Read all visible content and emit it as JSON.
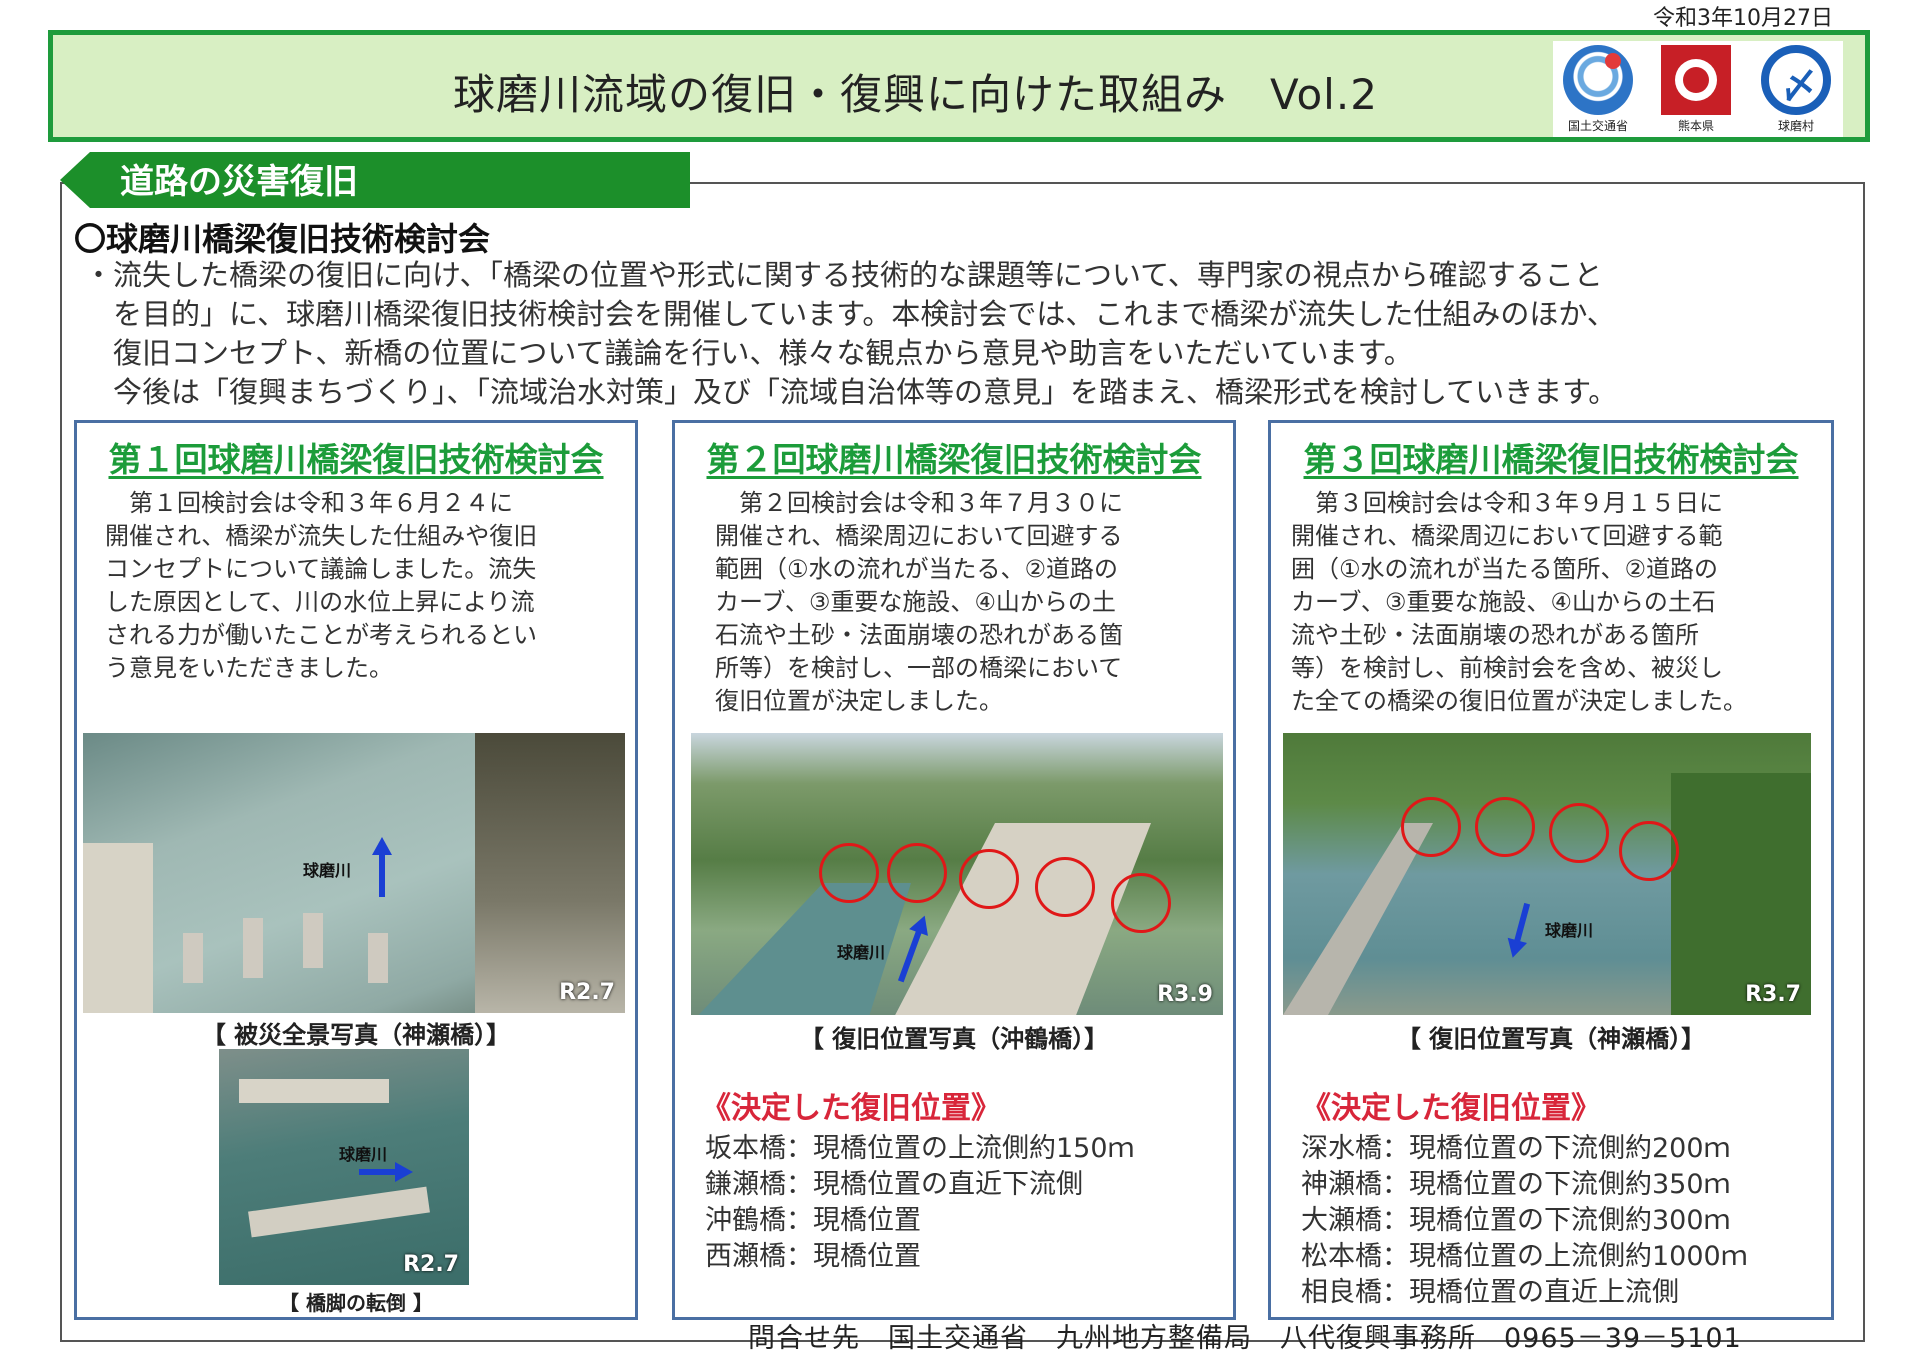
{
  "date": "令和3年10月27日",
  "header": {
    "title": "球磨川流域の復旧・復興に向けた取組み　Vol.2",
    "logos": [
      {
        "caption": "国土交通省",
        "icon": "mlit-logo-icon"
      },
      {
        "caption": "熊本県",
        "icon": "kumamoto-pref-logo-icon"
      },
      {
        "caption": "球磨村",
        "icon": "kuma-village-logo-icon"
      }
    ]
  },
  "section": {
    "tab_label": "道路の災害復旧",
    "heading": "〇球磨川橋梁復旧技術検討会",
    "intro_lines": [
      "・流失した橋梁の復旧に向け、「橋梁の位置や形式に関する技術的な課題等について、専門家の視点から確認すること",
      "　を目的」に、球磨川橋梁復旧技術検討会を開催しています。本検討会では、これまで橋梁が流失した仕組みのほか、",
      "　復旧コンセプト、新橋の位置について議論を行い、様々な観点から意見や助言をいただいています。",
      "　今後は「復興まちづくり」、「流域治水対策」及び「流域自治体等の意見」を踏まえ、橋梁形式を検討していきます。"
    ]
  },
  "panels": [
    {
      "title": "第１回球磨川橋梁復旧技術検討会",
      "text_lines": [
        "　第１回検討会は令和３年６月２４に",
        "開催され、橋梁が流失した仕組みや復旧",
        "コンセプトについて議論しました。流失",
        "した原因として、川の水位上昇により流",
        "される力が働いたことが考えられるとい",
        "う意見をいただきました。"
      ],
      "photo1": {
        "river_label": "球磨川",
        "stamp": "R2.7",
        "caption": "【 被災全景写真（神瀬橋）】"
      },
      "photo2": {
        "river_label": "球磨川",
        "stamp": "R2.7",
        "caption": "【 橋脚の転倒 】"
      }
    },
    {
      "title": "第２回球磨川橋梁復旧技術検討会",
      "text_lines": [
        "　第２回検討会は令和３年７月３０に",
        "開催され、橋梁周辺において回避する",
        "範囲（①水の流れが当たる、②道路の",
        "カーブ、③重要な施設、④山からの土",
        "石流や土砂・法面崩壊の恐れがある箇",
        "所等）を検討し、一部の橋梁において",
        "復旧位置が決定しました。"
      ],
      "photo": {
        "river_label": "球磨川",
        "stamp": "R3.9",
        "caption": "【 復旧位置写真（沖鶴橋）】"
      },
      "decided_title": "《決定した復旧位置》",
      "decided": [
        "坂本橋：現橋位置の上流側約150ｍ",
        "鎌瀬橋：現橋位置の直近下流側",
        "沖鶴橋：現橋位置",
        "西瀬橋：現橋位置"
      ]
    },
    {
      "title": "第３回球磨川橋梁復旧技術検討会",
      "text_lines": [
        "　第３回検討会は令和３年９月１５日に",
        "開催され、橋梁周辺において回避する範",
        "囲（①水の流れが当たる箇所、②道路の",
        "カーブ、③重要な施設、④山からの土石",
        "流や土砂・法面崩壊の恐れがある箇所",
        "等）を検討し、前検討会を含め、被災し",
        "た全ての橋梁の復旧位置が決定しました。"
      ],
      "photo": {
        "river_label": "球磨川",
        "stamp": "R3.7",
        "caption": "【 復旧位置写真（神瀬橋）】"
      },
      "decided_title": "《決定した復旧位置》",
      "decided": [
        "深水橋：現橋位置の下流側約200ｍ",
        "神瀬橋：現橋位置の下流側約350ｍ",
        "大瀬橋：現橋位置の下流側約300ｍ",
        "松本橋：現橋位置の上流側約1000ｍ",
        "相良橋：現橋位置の直近上流側"
      ]
    }
  ],
  "footer": "問合せ先　国土交通省　九州地方整備局　八代復興事務所　0965－39－5101"
}
